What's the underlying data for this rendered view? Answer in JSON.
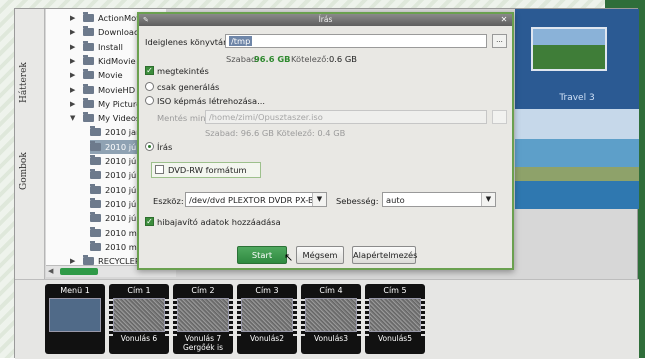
{
  "side_tabs": [
    "Hátterek",
    "Gombok"
  ],
  "tree": [
    {
      "label": "ActionMovie",
      "expanded": false
    },
    {
      "label": "Download",
      "expanded": false
    },
    {
      "label": "Install",
      "expanded": false
    },
    {
      "label": "KidMovie",
      "expanded": false
    },
    {
      "label": "Movie",
      "expanded": false
    },
    {
      "label": "MovieHD",
      "expanded": false
    },
    {
      "label": "My Pictures",
      "expanded": false
    },
    {
      "label": "My Videos",
      "expanded": true
    },
    {
      "label": "2010 január"
    },
    {
      "label": "2010 június",
      "selected": true
    },
    {
      "label": "2010 július 1"
    },
    {
      "label": "2010 július 1"
    },
    {
      "label": "2010 június 2"
    },
    {
      "label": "2010 június 3"
    },
    {
      "label": "2010 június 0"
    },
    {
      "label": "2010 május 2"
    },
    {
      "label": "2010 május 2"
    },
    {
      "label": "RECYCLER"
    }
  ],
  "preview": {
    "label": "Travel 3"
  },
  "menus": [
    {
      "title": "Menü 1",
      "sub": ""
    },
    {
      "title": "Cím 1",
      "sub": "Vonulás 6"
    },
    {
      "title": "Cím 2",
      "sub": "Vonulás 7 Gergőék is"
    },
    {
      "title": "Cím 3",
      "sub": "Vonulás2"
    },
    {
      "title": "Cím 4",
      "sub": "Vonulás3"
    },
    {
      "title": "Cím 5",
      "sub": "Vonulás5"
    }
  ],
  "dialog": {
    "title": "Írás",
    "temp_dir_label": "Ideiglenes könyvtár:",
    "temp_dir_value": "/tmp",
    "browse": "...",
    "free_label": "Szabad:",
    "free_value": "96.6 GB",
    "required_label": "Kötelező:",
    "required_value": "0.6 GB",
    "keep_label": "megtekintés",
    "opt_generate": "csak generálás",
    "opt_iso": "ISO képmás létrehozása...",
    "save_as_label": "Mentés mint:",
    "save_as_value": "/home/zimi/Opusztaszer.iso",
    "iso_free": "Szabad: 96.6 GB    Kötelező: 0.4 GB",
    "opt_write": "Írás",
    "dvdrw_label": "DVD-RW formátum",
    "device_label": "Eszköz:",
    "device_value": "/dev/dvd PLEXTOR DVDR   PX-B300",
    "speed_label": "Sebesség:",
    "speed_value": "auto",
    "ecc_label": "hibajavító adatok hozzáadása",
    "btn_start": "Start",
    "btn_cancel": "Mégsem",
    "btn_default": "Alapértelmezés"
  }
}
